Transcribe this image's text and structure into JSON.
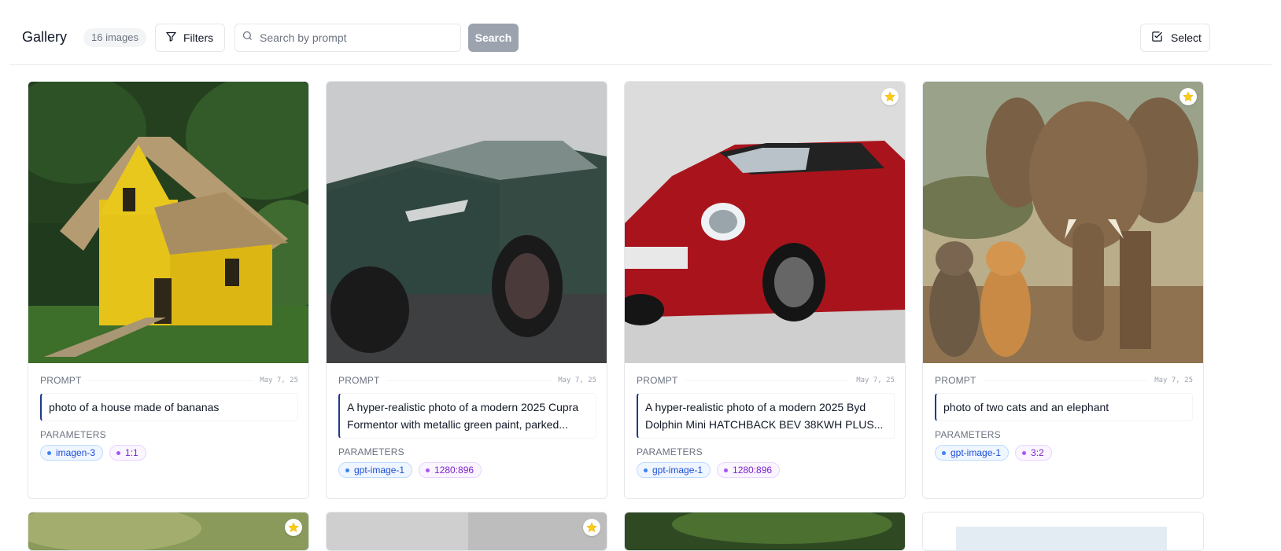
{
  "header": {
    "title": "Gallery",
    "count": "16 images",
    "filters_label": "Filters",
    "search_placeholder": "Search by prompt",
    "search_label": "Search",
    "select_label": "Select"
  },
  "labels": {
    "prompt": "PROMPT",
    "parameters": "PARAMETERS"
  },
  "cards": [
    {
      "date": "May 7, 25",
      "prompt": "photo of a house made of bananas",
      "model": "imagen-3",
      "ratio": "1:1",
      "starred": false
    },
    {
      "date": "May 7, 25",
      "prompt": "A hyper-realistic photo of a modern 2025 Cupra Formentor with metallic green paint, parked...",
      "model": "gpt-image-1",
      "ratio": "1280:896",
      "starred": false
    },
    {
      "date": "May 7, 25",
      "prompt": "A hyper-realistic photo of a modern 2025 Byd Dolphin Mini HATCHBACK BEV 38KWH PLUS...",
      "model": "gpt-image-1",
      "ratio": "1280:896",
      "starred": true
    },
    {
      "date": "May 7, 25",
      "prompt": "photo of two cats and an elephant",
      "model": "gpt-image-1",
      "ratio": "3:2",
      "starred": true
    }
  ],
  "colors": {
    "accent": "#1e3a8a",
    "star": "#facc15",
    "search_button": "#9ca3af"
  }
}
